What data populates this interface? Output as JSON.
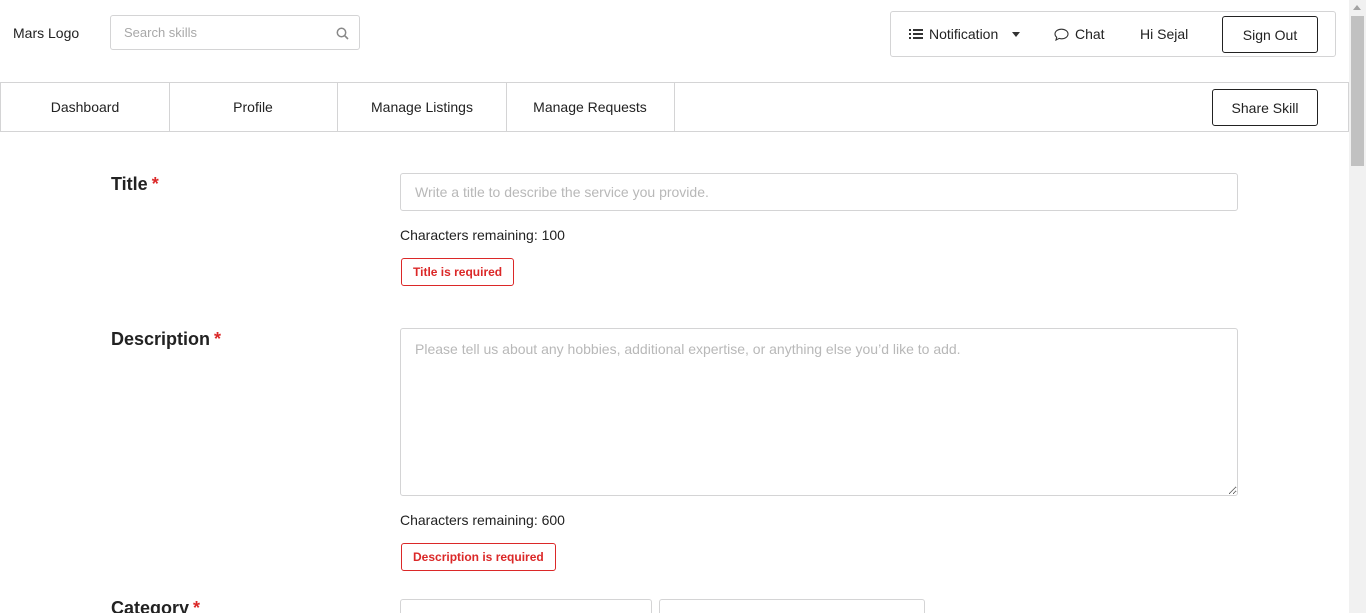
{
  "header": {
    "logo": "Mars Logo",
    "search_placeholder": "Search skills",
    "notification": "Notification",
    "chat": "Chat",
    "greeting": "Hi Sejal",
    "sign_out": "Sign Out"
  },
  "nav": {
    "items": [
      "Dashboard",
      "Profile",
      "Manage Listings",
      "Manage Requests"
    ],
    "share_skill": "Share Skill"
  },
  "form": {
    "title_label": "Title",
    "title_placeholder": "Write a title to describe the service you provide.",
    "title_counter": "Characters remaining: 100",
    "title_error": "Title is required",
    "description_label": "Description",
    "description_placeholder": "Please tell us about any hobbies, additional expertise, or anything else you’d like to add.",
    "description_counter": "Characters remaining: 600",
    "description_error": "Description is required",
    "category_label": "Category",
    "required_mark": "*"
  },
  "colors": {
    "error": "#db2828",
    "border": "#d4d4d5"
  }
}
